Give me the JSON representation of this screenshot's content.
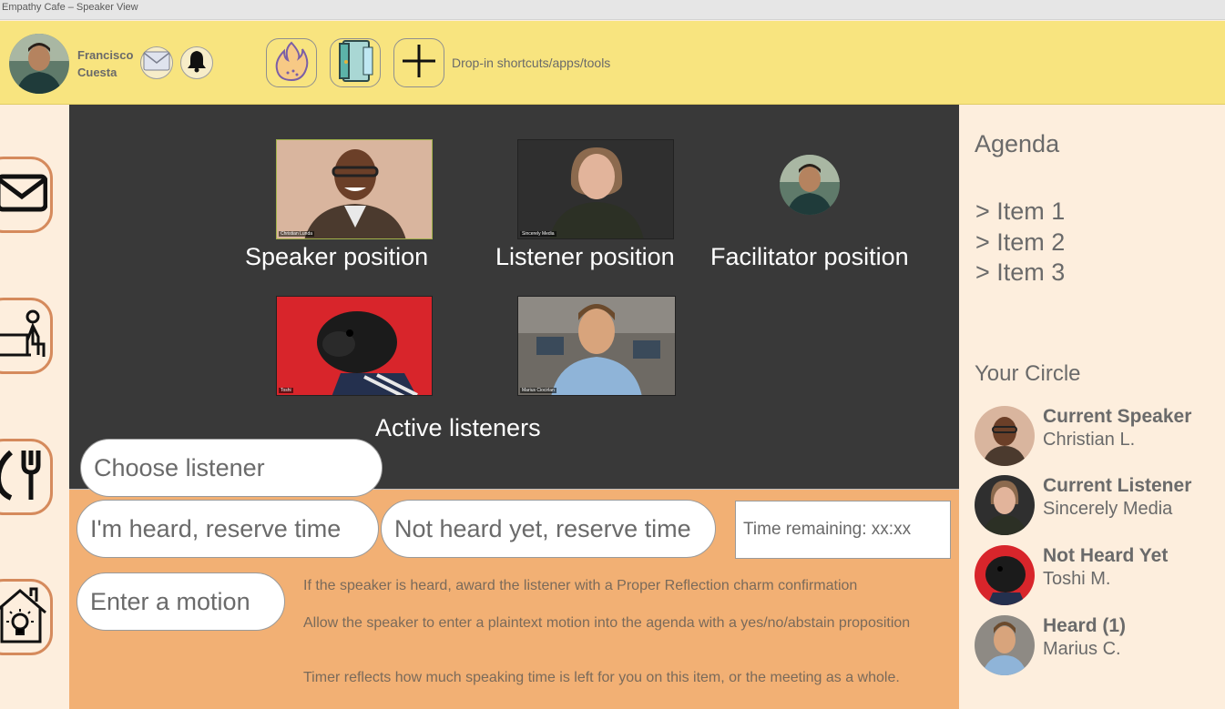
{
  "window": {
    "title": "Empathy Cafe – Speaker View"
  },
  "user": {
    "first_name": "Francisco",
    "last_name": "Cuesta"
  },
  "toolbar": {
    "shortcut_label": "Drop-in shortcuts/apps/tools"
  },
  "stage": {
    "speaker_label": "Speaker position",
    "listener_label": "Listener position",
    "facilitator_label": "Facilitator position",
    "active_listeners_label": "Active listeners",
    "tiles": {
      "speaker_tag": "Christian Lunda",
      "listener_tag": "Sincerely Media",
      "active1_tag": "Toshi",
      "active2_tag": "Marius Ciocirlan"
    }
  },
  "controls": {
    "choose_listener": "Choose listener",
    "heard_button": "I'm heard, reserve time",
    "not_heard_button": "Not heard yet, reserve time",
    "timer": "Time remaining: xx:xx",
    "motion_button": "Enter a motion",
    "notes": [
      "If the speaker is heard, award the listener with a Proper Reflection charm confirmation",
      "Allow the speaker to enter a plaintext motion into the agenda with a yes/no/abstain proposition",
      "Timer reflects how much speaking time is left for you on this item, or the meeting as a whole."
    ]
  },
  "agenda": {
    "title": "Agenda",
    "items": [
      "> Item 1",
      "> Item 2",
      "> Item 3"
    ]
  },
  "circle": {
    "title": "Your Circle",
    "members": [
      {
        "role": "Current Speaker",
        "name": "Christian L."
      },
      {
        "role": "Current Listener",
        "name": "Sincerely Media"
      },
      {
        "role": "Not Heard Yet",
        "name": "Toshi M."
      },
      {
        "role": "Heard (1)",
        "name": "Marius C."
      }
    ]
  },
  "colors": {
    "topbar": "#f8e47f",
    "stage": "#393939",
    "controls": "#f2b074",
    "panel": "#fdeedd",
    "rail_border": "#d58a5c"
  }
}
